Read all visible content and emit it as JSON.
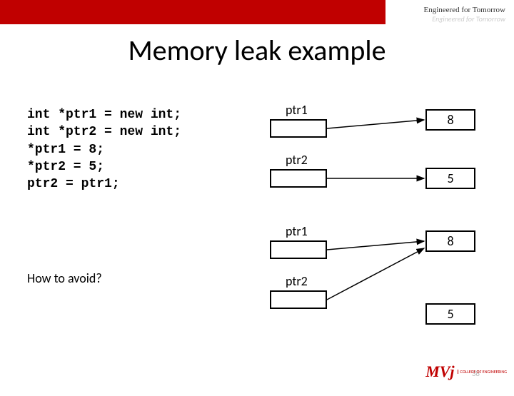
{
  "header": {
    "tagline": "Engineered for Tomorrow",
    "tagline_ghost": "Engineered for Tomorrow"
  },
  "title": "Memory leak example",
  "code": {
    "l1": "int *ptr1 = new int;",
    "l2": "int *ptr2 = new int;",
    "l3": "*ptr1 = 8;",
    "l4": "*ptr2 = 5;",
    "l5": "ptr2 = ptr1;"
  },
  "howto": "How to avoid?",
  "labels": {
    "ptr1": "ptr1",
    "ptr2": "ptr2",
    "v8": "8",
    "v5": "5"
  },
  "footer": {
    "logo": "MVj",
    "logo_sub": "COLLEGE OF\nENGINEERING",
    "page": "38"
  }
}
